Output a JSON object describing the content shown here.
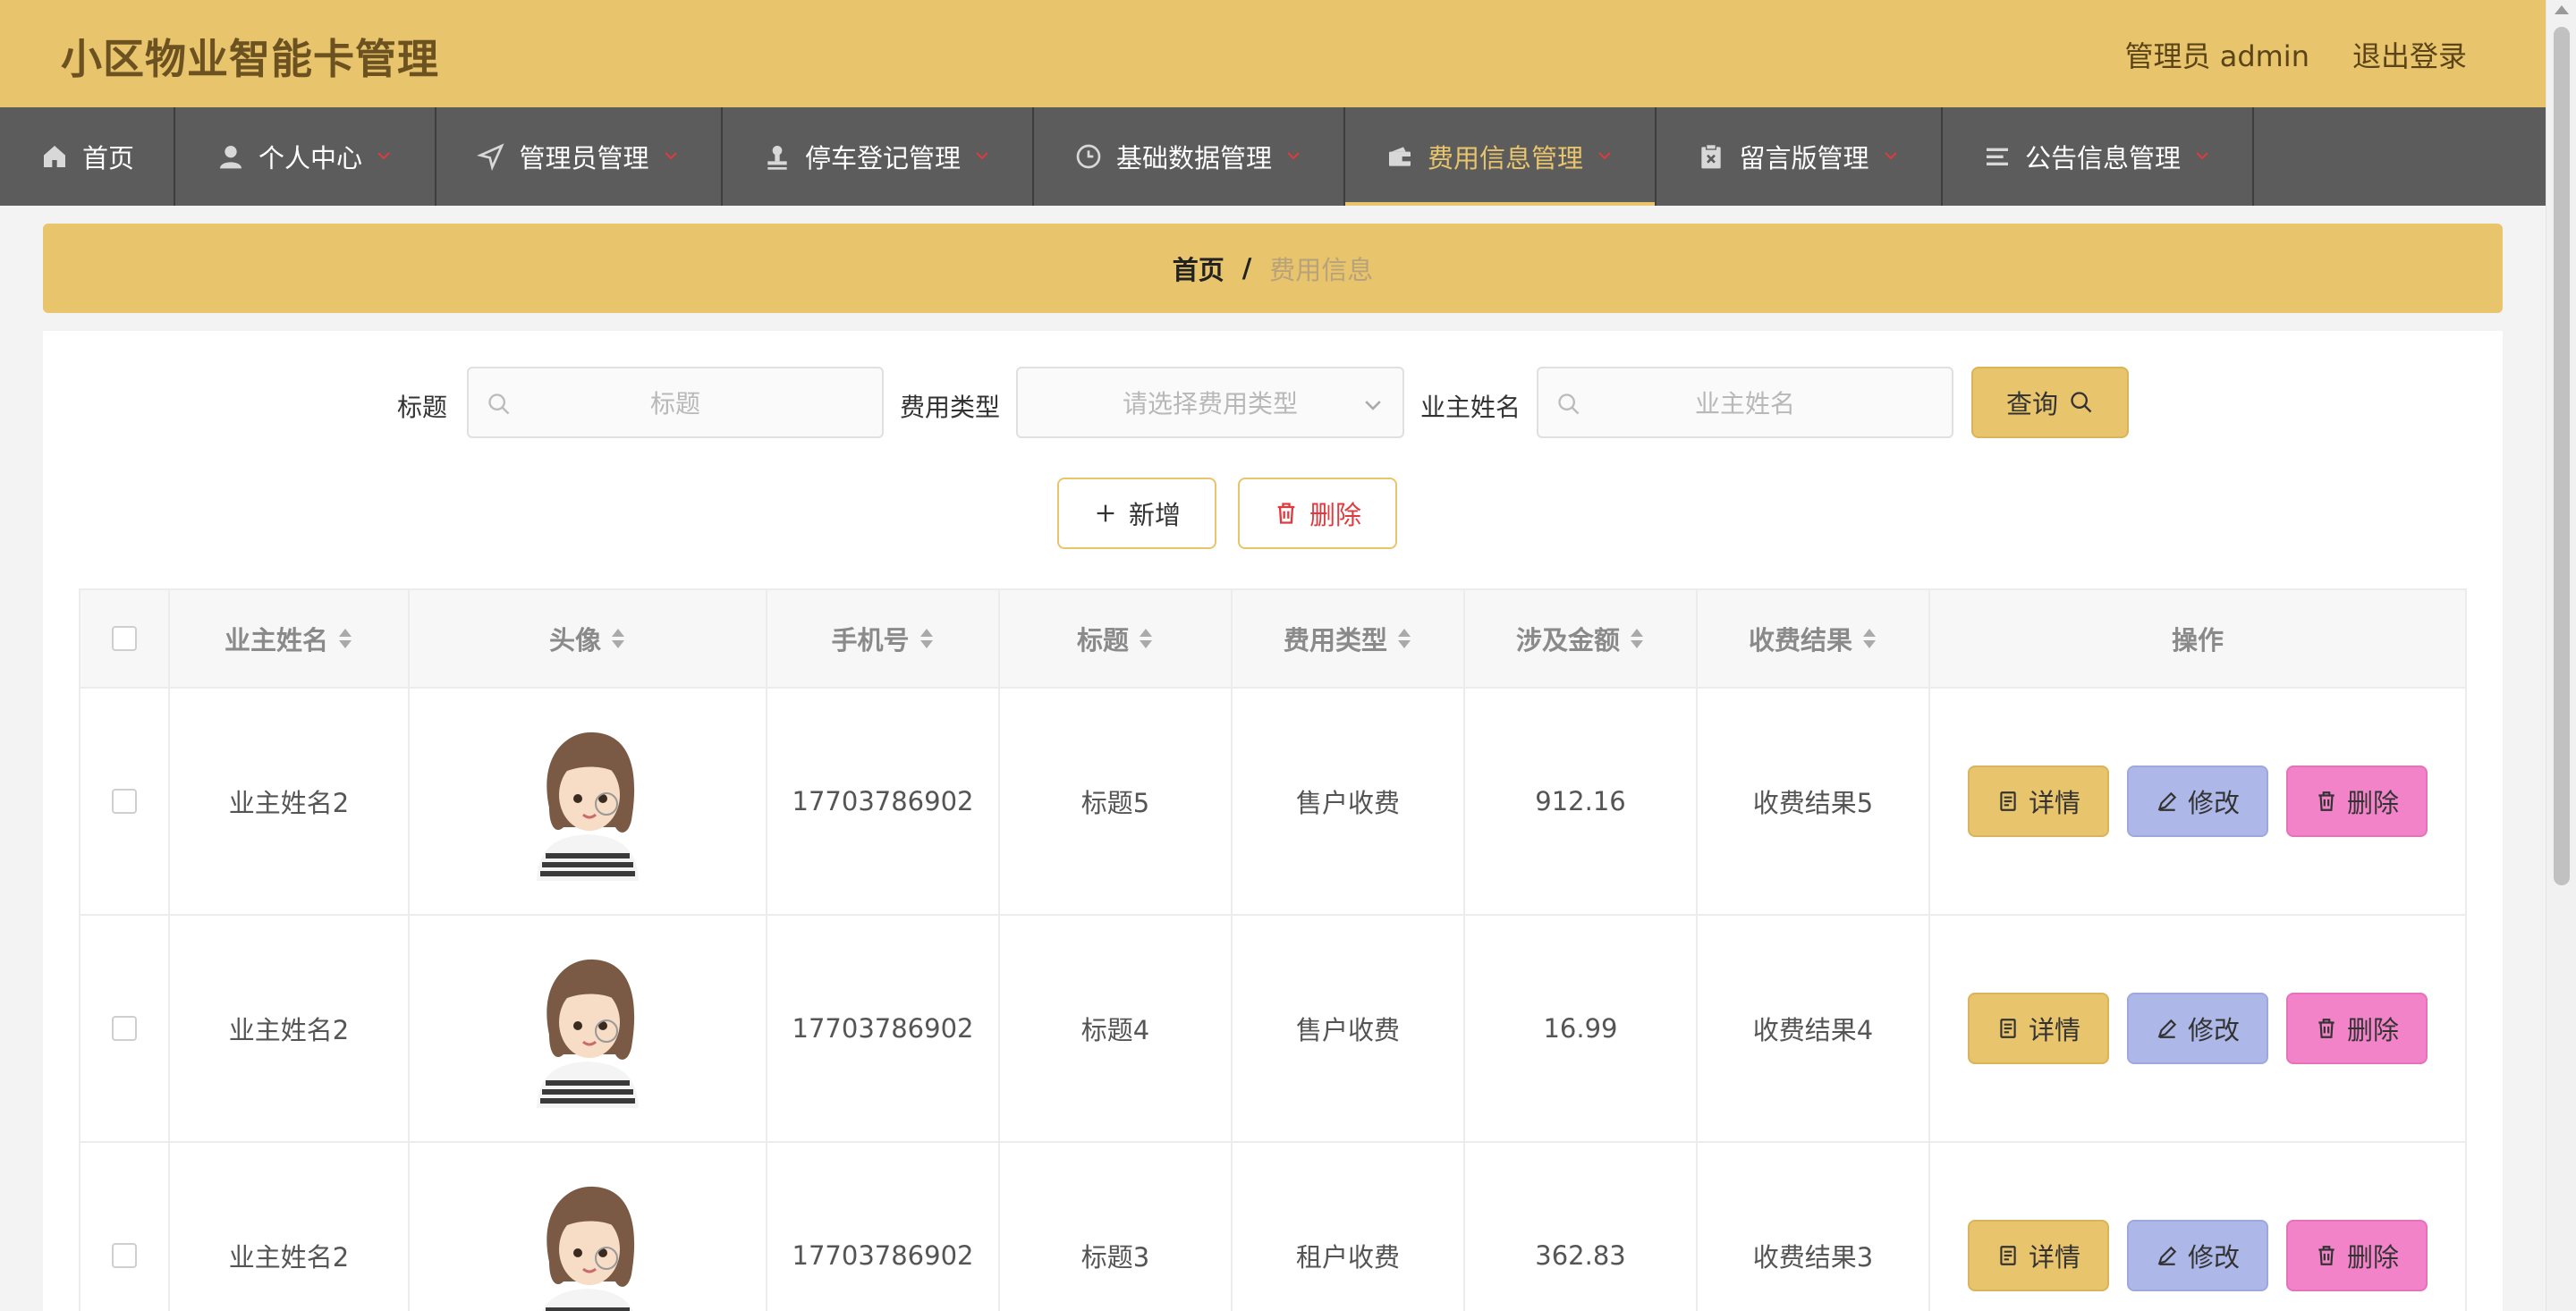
{
  "header": {
    "title": "小区物业智能卡管理",
    "admin_label": "管理员 admin",
    "logout_label": "退出登录"
  },
  "nav": {
    "items": [
      {
        "label": "首页",
        "icon": "home-icon"
      },
      {
        "label": "个人中心",
        "icon": "user-icon"
      },
      {
        "label": "管理员管理",
        "icon": "send-icon"
      },
      {
        "label": "停车登记管理",
        "icon": "stamp-icon"
      },
      {
        "label": "基础数据管理",
        "icon": "clock-icon"
      },
      {
        "label": "费用信息管理",
        "icon": "wallet-icon"
      },
      {
        "label": "留言版管理",
        "icon": "clipboard-icon"
      },
      {
        "label": "公告信息管理",
        "icon": "list-icon"
      }
    ],
    "active": "费用信息管理"
  },
  "breadcrumb": {
    "home": "首页",
    "separator": "/",
    "current": "费用信息"
  },
  "search": {
    "title_label": "标题",
    "title_placeholder": "标题",
    "type_label": "费用类型",
    "type_placeholder": "请选择费用类型",
    "owner_label": "业主姓名",
    "owner_placeholder": "业主姓名",
    "query_label": "查询"
  },
  "actions": {
    "add_label": "新增",
    "delete_label": "删除"
  },
  "table": {
    "headers": [
      "业主姓名",
      "头像",
      "手机号",
      "标题",
      "费用类型",
      "涉及金额",
      "收费结果",
      "操作"
    ],
    "rows": [
      {
        "owner": "业主姓名2",
        "phone": "17703786902",
        "title": "标题5",
        "type": "售户收费",
        "amount": "912.16",
        "result": "收费结果5"
      },
      {
        "owner": "业主姓名2",
        "phone": "17703786902",
        "title": "标题4",
        "type": "售户收费",
        "amount": "16.99",
        "result": "收费结果4"
      },
      {
        "owner": "业主姓名2",
        "phone": "17703786902",
        "title": "标题3",
        "type": "租户收费",
        "amount": "362.83",
        "result": "收费结果3"
      }
    ],
    "op_detail": "详情",
    "op_edit": "修改",
    "op_delete": "删除"
  },
  "colors": {
    "accent": "#e8c46c",
    "nav_bg": "#5c5c5c",
    "edit": "#aeb8e8",
    "delete": "#f283c8",
    "danger_text": "#e0393e"
  }
}
